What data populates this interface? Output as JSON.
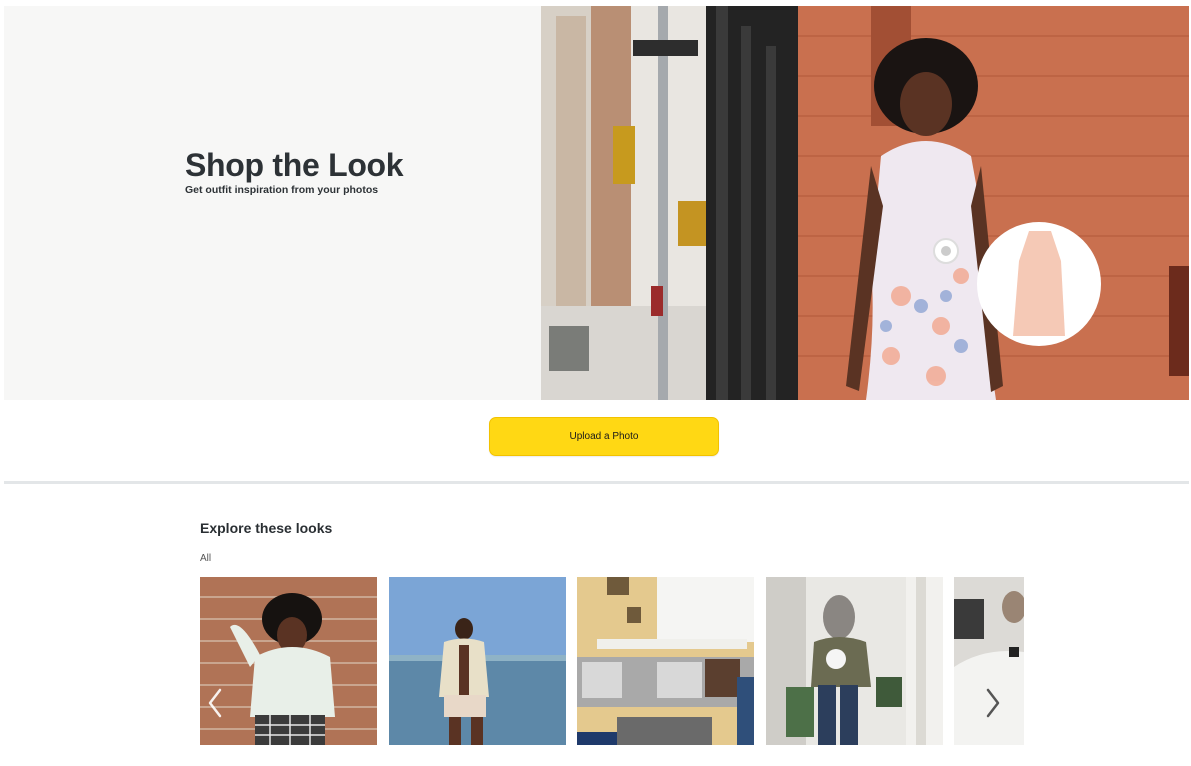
{
  "hero": {
    "title": "Shop the Look",
    "subtitle": "Get outfit inspiration from your photos",
    "photo_description_icon": "street-style-photo"
  },
  "upload": {
    "label": "Upload a Photo"
  },
  "explore": {
    "title": "Explore these looks",
    "filter_label": "All",
    "looks": [
      {
        "name": "look-white-sweater-brick-wall"
      },
      {
        "name": "look-beach-shirt"
      },
      {
        "name": "look-living-room-sofa"
      },
      {
        "name": "look-mirror-selfie"
      },
      {
        "name": "look-white-shirt"
      }
    ]
  },
  "colors": {
    "accent_button": "#ffd814",
    "hero_background": "#f7f7f6",
    "divider": "#e3e6e8"
  }
}
